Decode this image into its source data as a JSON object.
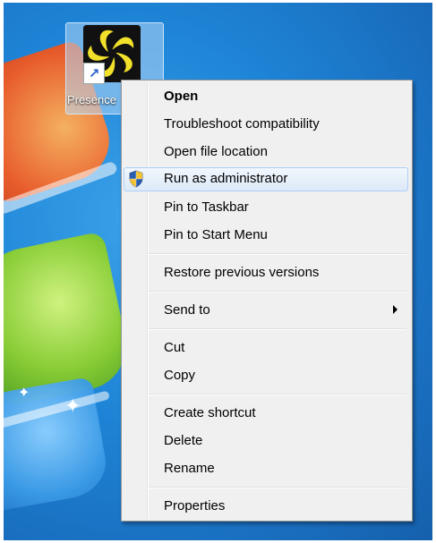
{
  "desktop": {
    "shortcut": {
      "label": "Presence"
    }
  },
  "context_menu": {
    "items": [
      {
        "label": "Open"
      },
      {
        "label": "Troubleshoot compatibility"
      },
      {
        "label": "Open file location"
      },
      {
        "label": "Run as administrator"
      },
      {
        "label": "Pin to Taskbar"
      },
      {
        "label": "Pin to Start Menu"
      },
      {
        "label": "Restore previous versions"
      },
      {
        "label": "Send to"
      },
      {
        "label": "Cut"
      },
      {
        "label": "Copy"
      },
      {
        "label": "Create shortcut"
      },
      {
        "label": "Delete"
      },
      {
        "label": "Rename"
      },
      {
        "label": "Properties"
      }
    ],
    "hovered_item": "Run as administrator",
    "bold_item": "Open",
    "submenu_item": "Send to",
    "icons": {
      "run_as_admin": "uac-shield-icon",
      "send_to": "submenu-arrow-icon"
    }
  },
  "colors": {
    "desktop_blue": "#1f86d8",
    "menu_bg": "#f0f0f0",
    "hover_border": "#aecff7"
  }
}
